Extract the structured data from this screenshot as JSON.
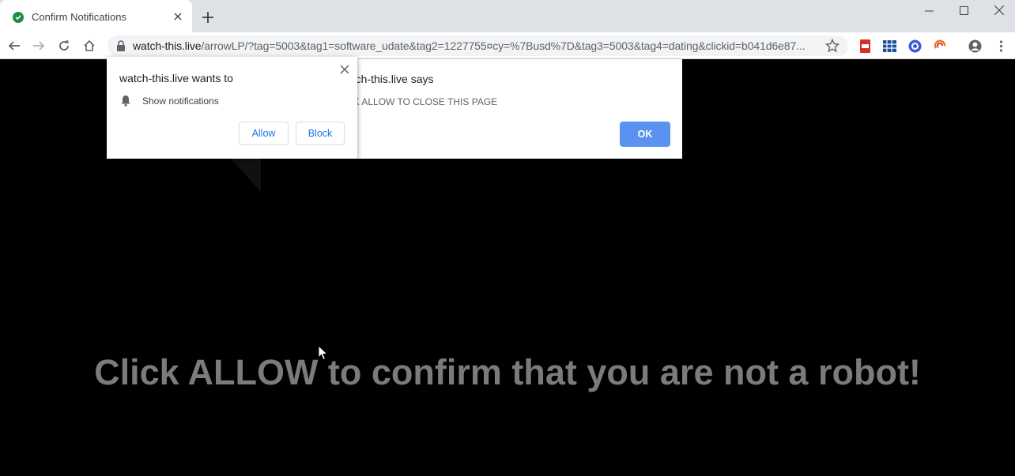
{
  "tab": {
    "title": "Confirm Notifications",
    "favicon": "check-circle-icon",
    "favicon_color": "#1e8e3e"
  },
  "window_controls": [
    "minimize-icon",
    "maximize-icon",
    "close-icon"
  ],
  "toolbar": {
    "url_host": "watch-this.live",
    "url_path": "/arrowLP/?tag=5003&tag1=software_udate&tag2=1227755¤cy=%7Busd%7D&tag3=5003&tag4=dating&clickid=b041d6e87..."
  },
  "extensions": [
    "pdf-extension-icon",
    "grid-extension-icon",
    "circle-extension-icon",
    "swirl-extension-icon"
  ],
  "permission_prompt": {
    "title": "watch-this.live wants to",
    "item": "Show notifications",
    "allow_label": "Allow",
    "block_label": "Block"
  },
  "alert_dialog": {
    "title": "atch-this.live says",
    "message": "CK ALLOW TO CLOSE THIS PAGE",
    "ok_label": "OK",
    "ok_color": "#5b92ef"
  },
  "page": {
    "headline": "Click ALLOW to confirm that you are not a robot!",
    "headline_color": "#7b7b7b",
    "background": "#000000"
  }
}
